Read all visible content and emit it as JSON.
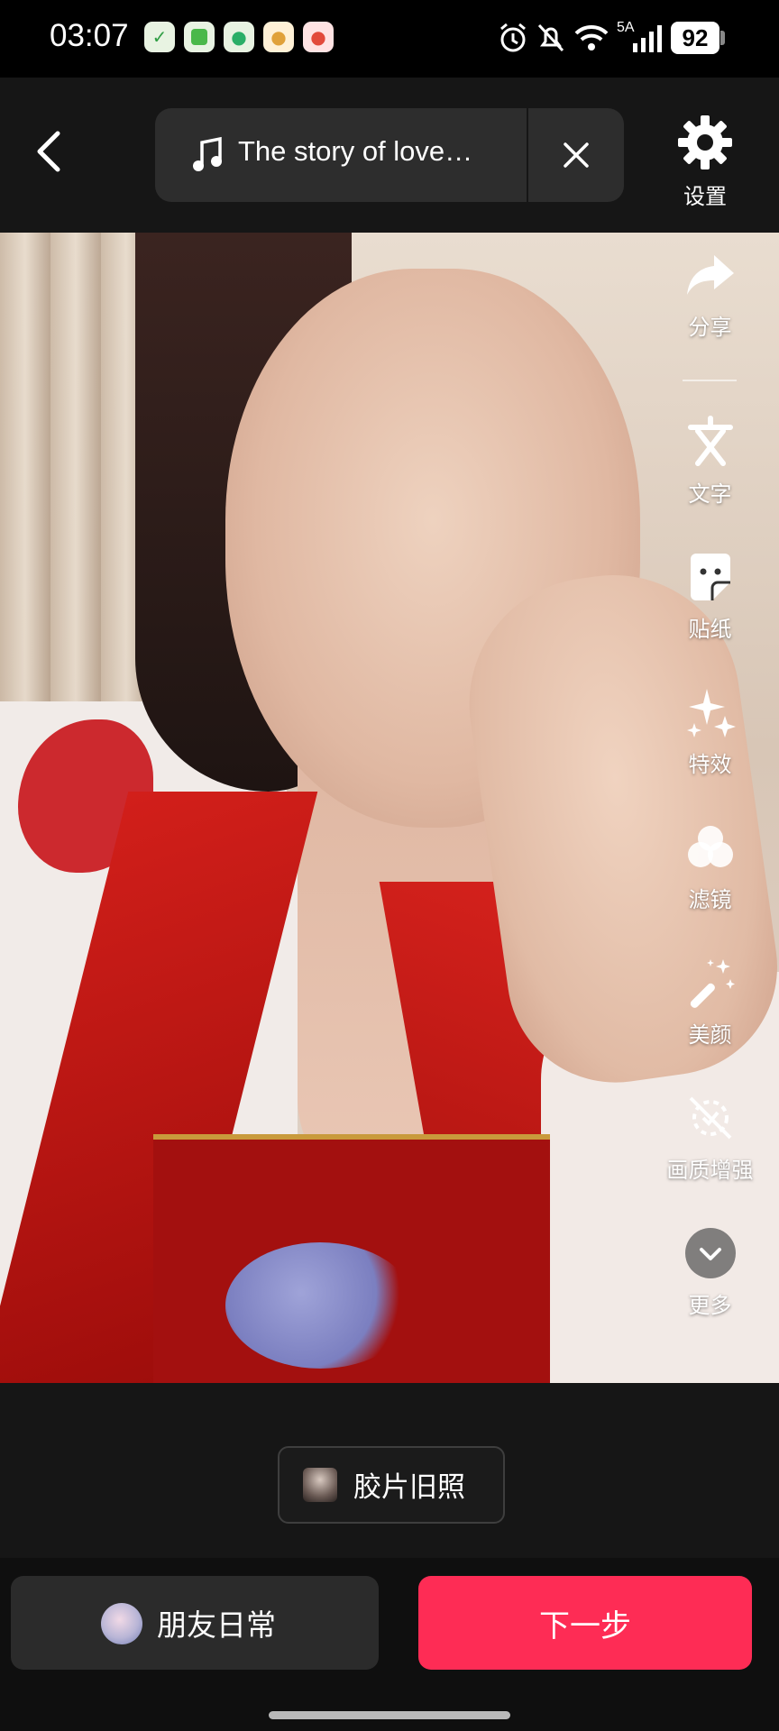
{
  "status_bar": {
    "time": "03:07",
    "network": "5A",
    "battery": "92",
    "notification_icons": [
      "app-icon-green",
      "app-icon-green-square",
      "wechat-icon",
      "app-icon-yellow",
      "app-icon-red"
    ]
  },
  "top_bar": {
    "music_title": "The story of love…",
    "settings_label": "设置"
  },
  "tools": [
    {
      "label": "分享",
      "icon": "share-icon"
    },
    {
      "label": "文字",
      "icon": "text-icon"
    },
    {
      "label": "贴纸",
      "icon": "sticker-icon"
    },
    {
      "label": "特效",
      "icon": "effects-icon"
    },
    {
      "label": "滤镜",
      "icon": "filter-icon"
    },
    {
      "label": "美颜",
      "icon": "beauty-icon"
    },
    {
      "label": "画质增强",
      "icon": "quality-enhance-icon"
    },
    {
      "label": "更多",
      "icon": "more-icon"
    }
  ],
  "filter_chip": {
    "label": "胶片旧照"
  },
  "bottom": {
    "friends_label": "朋友日常",
    "next_label": "下一步"
  },
  "colors": {
    "accent": "#fe2c55",
    "panel": "#2d2d2d",
    "background": "#161616"
  }
}
